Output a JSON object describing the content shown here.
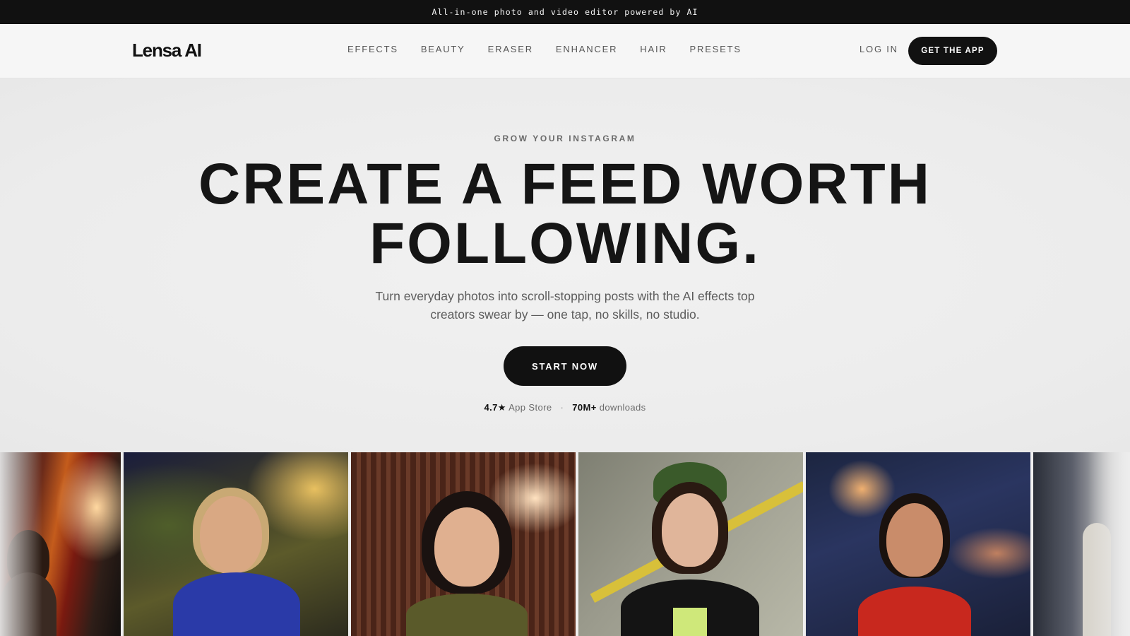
{
  "announcement": "All-in-one photo and video editor powered by AI",
  "nav": {
    "logo": "Lensa AI",
    "links": [
      "EFFECTS",
      "BEAUTY",
      "ERASER",
      "ENHANCER",
      "HAIR",
      "PRESETS"
    ],
    "login": "LOG IN",
    "cta": "GET THE APP"
  },
  "hero": {
    "eyebrow": "GROW YOUR INSTAGRAM",
    "headline_line1": "CREATE A FEED WORTH",
    "headline_line2": "FOLLOWING.",
    "subtitle": "Turn everyday photos into scroll-stopping posts with the AI effects top creators swear by — one tap, no skills, no studio.",
    "cta": "START NOW",
    "rating": "4.7★",
    "rating_label": "App Store",
    "separator": "·",
    "downloads": "70M+",
    "downloads_label": "downloads"
  },
  "colors": {
    "dark": "#111111",
    "background": "#eeeeee",
    "muted_text": "#5c5c5c"
  }
}
